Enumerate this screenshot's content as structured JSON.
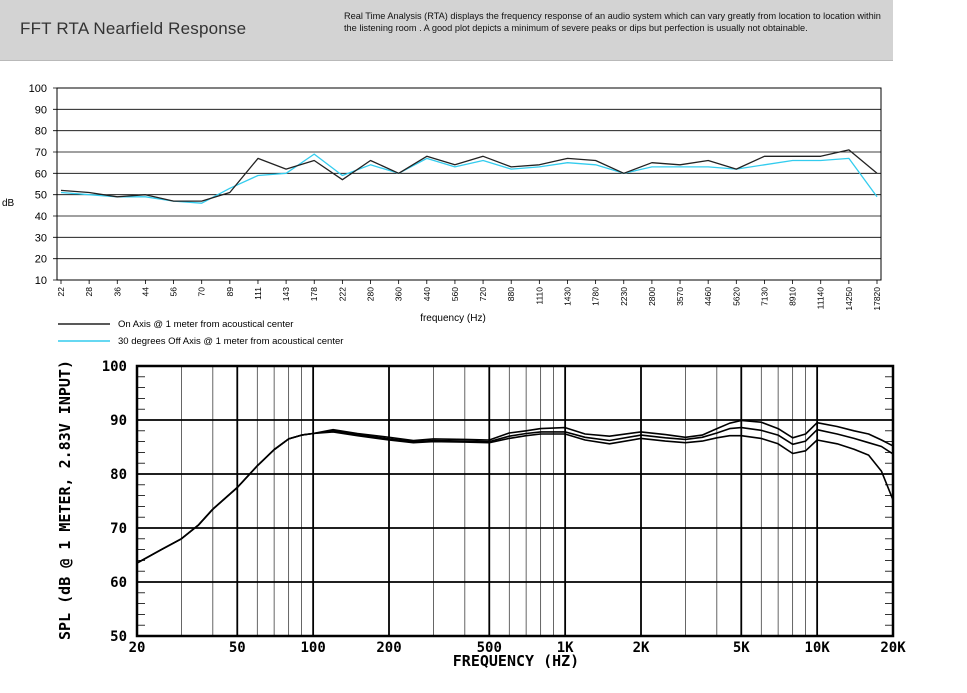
{
  "header": {
    "title": "FFT RTA Nearfield Response",
    "description": "Real Time Analysis (RTA) displays the frequency response of an audio system which can vary greatly from location to location within the listening room . A good plot depicts a minimum of severe peaks or dips but perfection is usually not obtainable."
  },
  "colors": {
    "on_axis": "#222222",
    "off_axis": "#33ccee",
    "header_bg": "#d3d3d3"
  },
  "chart_data": [
    {
      "type": "line",
      "title": "",
      "xlabel": "frequency (Hz)",
      "ylabel": "dB",
      "ylim": [
        10,
        100
      ],
      "yticks": [
        10,
        20,
        30,
        40,
        50,
        60,
        70,
        80,
        90,
        100
      ],
      "grid": true,
      "legend_position": "bottom-left",
      "categories": [
        "22",
        "28",
        "36",
        "44",
        "56",
        "70",
        "89",
        "111",
        "143",
        "178",
        "222",
        "280",
        "360",
        "440",
        "560",
        "720",
        "880",
        "1110",
        "1430",
        "1780",
        "2230",
        "2800",
        "3570",
        "4460",
        "5620",
        "7130",
        "8910",
        "11140",
        "14250",
        "17820"
      ],
      "series": [
        {
          "name": "On Axis @ 1 meter from acoustical center",
          "values": [
            52,
            51,
            49,
            50,
            47,
            47,
            51,
            67,
            62,
            66,
            57,
            66,
            60,
            68,
            64,
            68,
            63,
            64,
            67,
            66,
            60,
            65,
            64,
            66,
            62,
            68,
            68,
            68,
            71,
            60
          ]
        },
        {
          "name": "30 degrees Off Axis @ 1 meter from acoustical center",
          "values": [
            51,
            50,
            49,
            49,
            47,
            46,
            53,
            59,
            60,
            69,
            59,
            64,
            60,
            67,
            63,
            66,
            62,
            63,
            65,
            64,
            60,
            63,
            63,
            63,
            62,
            64,
            66,
            66,
            67,
            49
          ]
        }
      ]
    },
    {
      "type": "line",
      "title": "",
      "xlabel": "FREQUENCY (HZ)",
      "ylabel": "SPL (dB @ 1 METER, 2.83V INPUT)",
      "ylim": [
        50,
        100
      ],
      "yticks": [
        50,
        60,
        70,
        80,
        90,
        100
      ],
      "xlim": [
        20,
        20000
      ],
      "x_scale": "log",
      "grid": true,
      "xtick_values": [
        20,
        50,
        100,
        200,
        500,
        1000,
        2000,
        5000,
        10000,
        20000
      ],
      "xtick_labels": [
        "20",
        "50",
        "100",
        "200",
        "500",
        "1K",
        "2K",
        "5K",
        "10K",
        "20K"
      ],
      "x": [
        20,
        25,
        30,
        35,
        40,
        50,
        60,
        70,
        80,
        90,
        100,
        120,
        150,
        200,
        250,
        300,
        400,
        500,
        600,
        700,
        800,
        1000,
        1200,
        1500,
        2000,
        2500,
        3000,
        3500,
        4000,
        4500,
        5000,
        6000,
        7000,
        8000,
        9000,
        10000,
        12000,
        14000,
        16000,
        18000,
        20000
      ],
      "series": [
        {
          "values": [
            63.5,
            66,
            68,
            70.5,
            73.5,
            77.5,
            81.5,
            84.5,
            86.5,
            87.2,
            87.5,
            88.2,
            87.5,
            86.8,
            86.2,
            86.5,
            86.4,
            86.3,
            87.6,
            88,
            88.4,
            88.6,
            87.4,
            87,
            87.8,
            87.3,
            86.8,
            87.2,
            88.4,
            89.4,
            89.9,
            89.6,
            88.4,
            86.7,
            87.4,
            89.5,
            88.8,
            88,
            87.4,
            86.3,
            85.2
          ]
        },
        {
          "values": [
            63.5,
            66,
            68,
            70.5,
            73.5,
            77.5,
            81.5,
            84.5,
            86.5,
            87.2,
            87.5,
            88,
            87.3,
            86.5,
            86,
            86.2,
            86.1,
            86,
            87,
            87.5,
            87.8,
            87.8,
            86.8,
            86.2,
            87.2,
            86.7,
            86.4,
            86.8,
            87.6,
            88.4,
            88.6,
            88.1,
            87.2,
            85.5,
            86.1,
            88.2,
            87.4,
            86.6,
            85.8,
            85.1,
            83.7
          ]
        },
        {
          "values": [
            63.5,
            66,
            68,
            70.5,
            73.5,
            77.5,
            81.5,
            84.5,
            86.5,
            87.2,
            87.5,
            87.8,
            87.1,
            86.3,
            85.8,
            86,
            85.9,
            85.8,
            86.6,
            87.1,
            87.4,
            87.4,
            86.3,
            85.6,
            86.6,
            86.1,
            85.8,
            86.1,
            86.7,
            87.1,
            87.1,
            86.6,
            85.6,
            83.8,
            84.3,
            86.3,
            85.6,
            84.6,
            83.5,
            80.5,
            75.2
          ]
        }
      ]
    }
  ]
}
